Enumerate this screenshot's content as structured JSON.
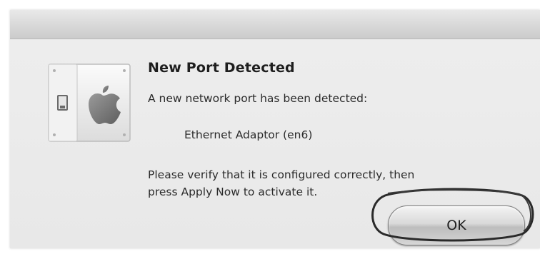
{
  "dialog": {
    "title": "New Port Detected",
    "message": "A new network port has been detected:",
    "port_name": "Ethernet Adaptor (en6)",
    "instruction_line1": "Please verify that it is configured correctly, then",
    "instruction_line2": "press Apply Now to activate it.",
    "ok_label": "OK"
  },
  "icons": {
    "app_icon": "network-port-icon"
  }
}
